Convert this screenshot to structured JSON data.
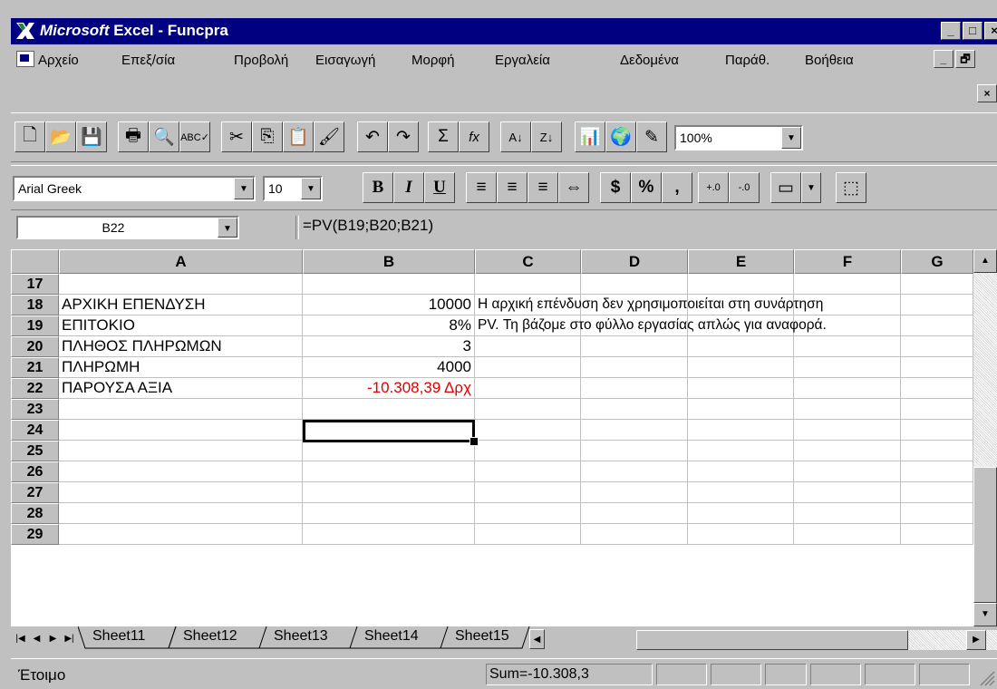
{
  "window": {
    "title_brand": "Microsoft",
    "title_rest": " Excel - Funcpra",
    "caption_buttons": [
      "_",
      "□",
      "×"
    ]
  },
  "menu": {
    "items": [
      "Αρχείο",
      "Επεξ/σία",
      "Προβολή",
      "Εισαγωγή",
      "Μορφή",
      "Εργαλεία",
      "Δεδομένα",
      "Παράθ.",
      "Βοήθεια"
    ],
    "mdi_buttons": [
      "_",
      "🗗",
      "×"
    ]
  },
  "toolbar1": {
    "icons": [
      "new-icon",
      "open-icon",
      "save-icon",
      "print-icon",
      "print-preview-icon",
      "spelling-icon",
      "cut-icon",
      "copy-icon",
      "paste-icon",
      "format-painter-icon",
      "undo-icon",
      "redo-icon",
      "autosum-icon",
      "function-icon",
      "sort-ascending-icon",
      "sort-descending-icon",
      "chart-wizard-icon",
      "map-icon",
      "drawing-icon"
    ],
    "glyphs": [
      "🗋",
      "📂",
      "💾",
      "🖶",
      "🔍",
      "ABC✓",
      "✂",
      "⎘",
      "📋",
      "🖌",
      "↶",
      "↷",
      "Σ",
      "fx",
      "A↓",
      "Z↓",
      "📊",
      "🌍",
      "✎"
    ],
    "zoom": "100%"
  },
  "toolbar2": {
    "font": "Arial Greek",
    "size": "10",
    "format_glyphs": [
      "B",
      "I",
      "U",
      "≡",
      "≡",
      "≡",
      "⇔",
      "$",
      "%",
      ",",
      "+.0",
      "-.0",
      "▭",
      "⬚"
    ],
    "format_icons": [
      "bold-icon",
      "italic-icon",
      "underline-icon",
      "align-left-icon",
      "align-center-icon",
      "align-right-icon",
      "merge-center-icon",
      "currency-icon",
      "percent-icon",
      "comma-icon",
      "increase-decimal-icon",
      "decrease-decimal-icon",
      "borders-icon",
      "fill-color-icon"
    ]
  },
  "formula_bar": {
    "name_box": "B22",
    "formula": "=PV(B19;B20;B21)"
  },
  "grid": {
    "columns": [
      "A",
      "B",
      "C",
      "D",
      "E",
      "F",
      "G"
    ],
    "rows": [
      {
        "n": "17",
        "a": "",
        "b": "",
        "c": ""
      },
      {
        "n": "18",
        "a": "ΑΡΧΙΚΗ ΕΠΕΝΔΥΣΗ",
        "b": "10000",
        "c": "Η αρχική επένδυση δεν χρησιμοποιείται στη συνάρτηση"
      },
      {
        "n": "19",
        "a": "ΕΠΙΤΟΚΙΟ",
        "b": "8%",
        "c": "PV.  Τη βάζομε στο φύλλο εργασίας απλώς για αναφορά."
      },
      {
        "n": "20",
        "a": "ΠΛΗΘΟΣ ΠΛΗΡΩΜΩΝ",
        "b": "3",
        "c": ""
      },
      {
        "n": "21",
        "a": "ΠΛΗΡΩΜΗ",
        "b": "4000",
        "c": ""
      },
      {
        "n": "22",
        "a": "ΠΑΡΟΥΣΑ ΑΞΙΑ",
        "b": "-10.308,39 Δρχ",
        "c": ""
      },
      {
        "n": "23",
        "a": "",
        "b": "",
        "c": ""
      },
      {
        "n": "24",
        "a": "",
        "b": "",
        "c": ""
      },
      {
        "n": "25",
        "a": "",
        "b": "",
        "c": ""
      },
      {
        "n": "26",
        "a": "",
        "b": "",
        "c": ""
      },
      {
        "n": "27",
        "a": "",
        "b": "",
        "c": ""
      },
      {
        "n": "28",
        "a": "",
        "b": "",
        "c": ""
      },
      {
        "n": "29",
        "a": "",
        "b": "",
        "c": ""
      }
    ],
    "negative_color": "#e00000"
  },
  "sheet_tabs": [
    "Sheet11",
    "Sheet12",
    "Sheet13",
    "Sheet14",
    "Sheet15"
  ],
  "status": {
    "ready": "Έτοιμο",
    "sum": "Sum=-10.308,3"
  },
  "colors": {
    "titlebar": "#000080",
    "face": "#c0c0c0"
  }
}
